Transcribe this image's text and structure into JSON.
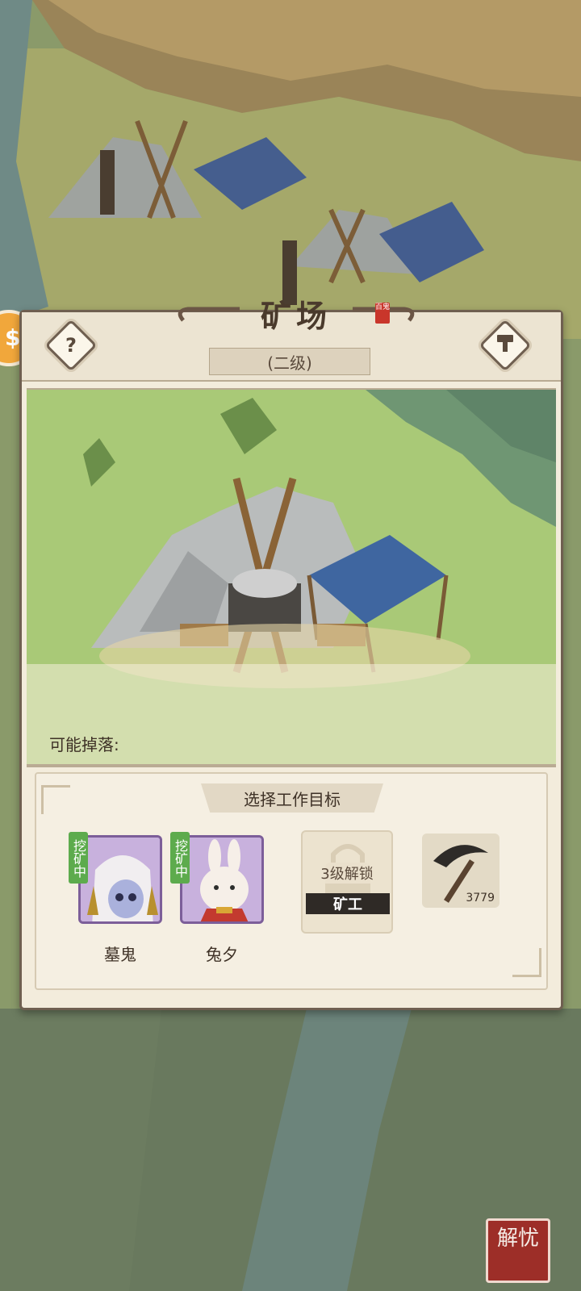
{
  "building": {
    "title": "矿场",
    "title_seal": "百鬼",
    "level": "(二级)"
  },
  "drops": {
    "label": "可能掉落:",
    "items": [
      "dark-ore-icon",
      "gold-ore-icon",
      "crystal-ore-icon"
    ]
  },
  "work_target": {
    "title": "选择工作目标",
    "workers": [
      {
        "name": "墓鬼",
        "status": "挖矿中"
      },
      {
        "name": "兔夕",
        "status": "挖矿中"
      }
    ],
    "locked_slot": {
      "unlock_text": "3级解锁",
      "type": "矿工"
    },
    "tool": {
      "icon": "pickaxe-icon",
      "count": "3779"
    }
  },
  "corner_badge": "解忧",
  "colors": {
    "panel_bg": "#f3ecdc",
    "panel_border": "#6f5f50",
    "status_green": "#5dab4d",
    "worker_frame": "#bfa6d4",
    "seal_red": "#9d2e28"
  }
}
